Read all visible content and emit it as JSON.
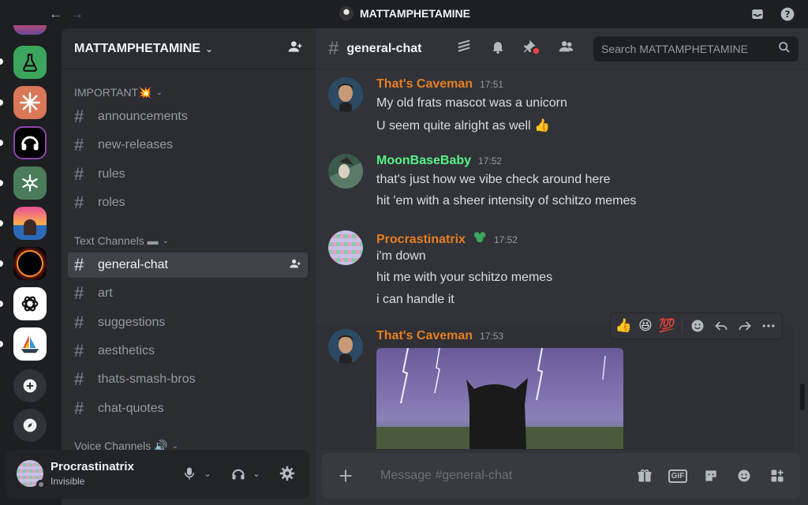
{
  "titlebar": {
    "title": "MATTAMPHETAMINE",
    "icons": [
      "back-arrow-icon",
      "forward-arrow-icon",
      "inbox-icon",
      "help-icon"
    ]
  },
  "servers": [
    {
      "name": "server-partial",
      "color": "#b04a7a"
    },
    {
      "name": "server-flask",
      "color": "#3ba55d"
    },
    {
      "name": "server-burst",
      "color": "#d97757"
    },
    {
      "name": "server-headphones",
      "color": "#000000"
    },
    {
      "name": "server-snowflake",
      "color": "#4a7c59"
    },
    {
      "name": "server-sunset",
      "color": "#c54a8a"
    },
    {
      "name": "server-eclipse",
      "color": "#000000"
    },
    {
      "name": "server-openai",
      "color": "#ffffff"
    },
    {
      "name": "server-boat",
      "color": "#ffffff"
    }
  ],
  "guild": {
    "name": "MATTAMPHETAMINE"
  },
  "categories": {
    "important": "IMPORTANT💥",
    "text": "Text Channels ▬",
    "voice": "Voice Channels 🔊"
  },
  "channels": {
    "important": [
      "announcements",
      "new-releases",
      "rules",
      "roles"
    ],
    "text": [
      "general-chat",
      "art",
      "suggestions",
      "aesthetics",
      "thats-smash-bros",
      "chat-quotes"
    ]
  },
  "user": {
    "name": "Procrastinatrix",
    "status": "Invisible"
  },
  "channel_header": {
    "name": "general-chat",
    "search_placeholder": "Search MATTAMPHETAMINE"
  },
  "messages": [
    {
      "author": "That's Caveman",
      "color": "#e67e22",
      "time": "17:51",
      "lines": [
        "My old frats mascot was a unicorn",
        "U seem quite alright as well 👍"
      ]
    },
    {
      "author": "MoonBaseBaby",
      "color": "#57f287",
      "time": "17:52",
      "lines": [
        "that's just how we vibe check around here",
        "hit 'em with a sheer intensity of schitzo memes"
      ]
    },
    {
      "author": "Procrastinatrix",
      "color": "#e67e22",
      "time": "17:52",
      "lines": [
        "i'm down",
        "hit me with your schitzo memes",
        "i can handle it"
      ]
    },
    {
      "author": "That's Caveman",
      "color": "#e67e22",
      "time": "17:53",
      "lines": []
    }
  ],
  "reactions": [
    "👍",
    "😆",
    "💯"
  ],
  "composer": {
    "placeholder": "Message #general-chat"
  }
}
